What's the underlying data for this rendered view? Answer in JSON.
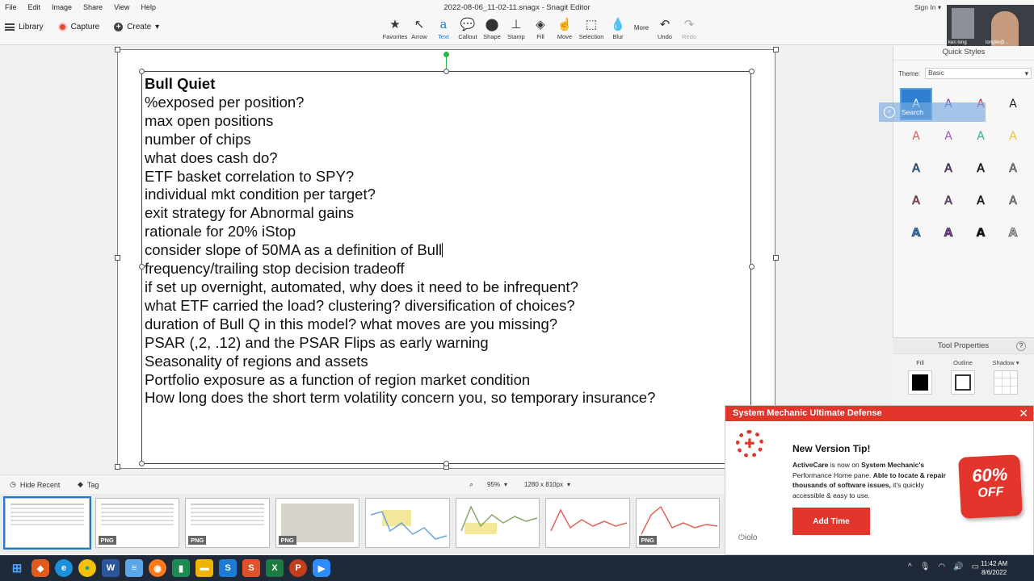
{
  "menubar": {
    "items": [
      "File",
      "Edit",
      "Image",
      "Share",
      "View",
      "Help"
    ],
    "window_title": "2022-08-06_11-02-11.snagx - Snagit Editor",
    "sign_in": "Sign In"
  },
  "toolbar": {
    "library": "Library",
    "capture": "Capture",
    "create": "Create",
    "tools": [
      {
        "label": "Favorites",
        "icon": "star-icon"
      },
      {
        "label": "Arrow",
        "icon": "arrow-icon"
      },
      {
        "label": "Text",
        "icon": "text-icon"
      },
      {
        "label": "Callout",
        "icon": "callout-icon"
      },
      {
        "label": "Shape",
        "icon": "shape-icon"
      },
      {
        "label": "Stamp",
        "icon": "stamp-icon"
      },
      {
        "label": "Fill",
        "icon": "fill-icon"
      },
      {
        "label": "Move",
        "icon": "move-icon"
      },
      {
        "label": "Selection",
        "icon": "selection-icon"
      },
      {
        "label": "Blur",
        "icon": "blur-icon"
      },
      {
        "label": "More",
        "icon": "more-icon"
      },
      {
        "label": "Undo",
        "icon": "undo-icon"
      },
      {
        "label": "Redo",
        "icon": "redo-icon"
      }
    ],
    "active_tool": "Text"
  },
  "note": {
    "heading": "Bull Quiet",
    "lines": [
      "%exposed per position?",
      "max open positions",
      "number of chips",
      "what does cash do?",
      "ETF basket correlation to SPY?",
      "individual mkt condition per target?",
      "exit strategy for Abnormal gains",
      "rationale for 20% iStop",
      "consider slope of 50MA as a definition of Bull",
      "frequency/trailing stop decision tradeoff",
      "if set up overnight, automated, why does it need to be infrequent?",
      "what ETF carried the load?  clustering? diversification of choices?",
      "duration of Bull Q in this model?  what moves are you missing?",
      "PSAR (,2, .12) and the PSAR Flips as early warning",
      "Seasonality of regions and assets",
      "Portfolio exposure as a function of region market condition",
      "How long does the short term volatility concern you, so temporary insurance?"
    ]
  },
  "quick_styles": {
    "title": "Quick Styles",
    "theme_label": "Theme:",
    "theme_value": "Basic",
    "glyph": "A",
    "colors": [
      "#2e7fcf",
      "#7b3fa0",
      "#c0304a",
      "#222222",
      "#e05a5a",
      "#9b59b6",
      "#2fb37e",
      "#e8c53a"
    ],
    "overlay_text": "Search"
  },
  "tool_properties": {
    "title": "Tool Properties",
    "help": "?",
    "fill": "Fill",
    "outline": "Outline",
    "shadow": "Shadow"
  },
  "tray": {
    "hide_recent": "Hide Recent",
    "tag": "Tag",
    "zoom": "95%",
    "dimensions": "1280 x 810px",
    "png_badge": "PNG"
  },
  "popup": {
    "title": "System Mechanic Ultimate Defense",
    "heading": "New Version Tip!",
    "body_1": "ActiveCare",
    "body_2": " is now on ",
    "body_3": "System Mechanic's",
    "body_4": " Performance Home pane. ",
    "body_5": "Able to locate & repair thousands of software issues,",
    "body_6": " it's quickly accessible & easy to use.",
    "button": "Add Time",
    "brand": "iolo",
    "badge_big": "60%",
    "badge_small": "OFF",
    "accent": "#e2352b"
  },
  "webcam": {
    "left_name": "ken long",
    "right_name": "longke@..."
  },
  "taskbar": {
    "time": "11:42 AM",
    "date": "8/6/2022"
  }
}
